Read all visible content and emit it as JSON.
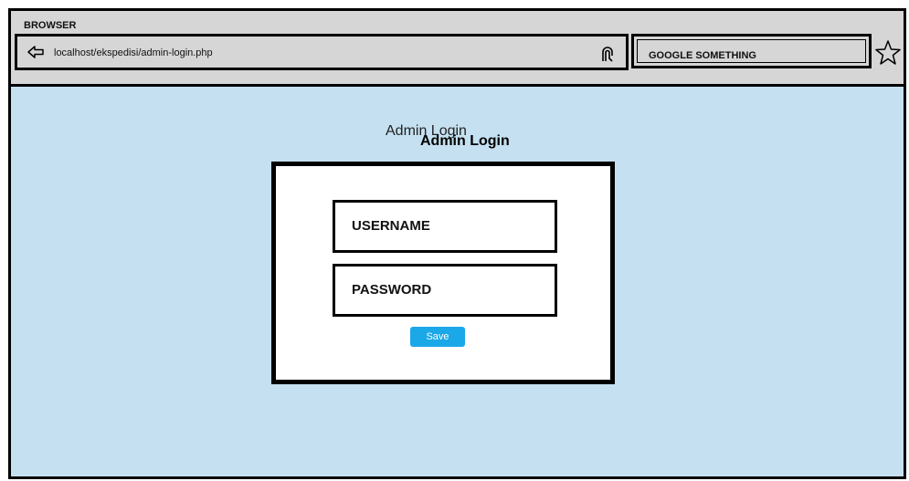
{
  "browser": {
    "title": "BROWSER",
    "url": "localhost/ekspedisi/admin-login.php",
    "search_placeholder": "GOOGLE SOMETHING"
  },
  "page": {
    "title_back": "Admin Login",
    "title_front": "Admin Login"
  },
  "form": {
    "username_label": "USERNAME",
    "password_label": "PASSWORD",
    "save_label": "Save"
  },
  "colors": {
    "content_background": "#c5e0f0",
    "save_button": "#1aa8e8",
    "chrome_background": "#d6d6d6"
  },
  "icons": {
    "back": "back-arrow-icon",
    "fingerprint": "fingerprint-icon",
    "bookmark": "star-icon"
  }
}
